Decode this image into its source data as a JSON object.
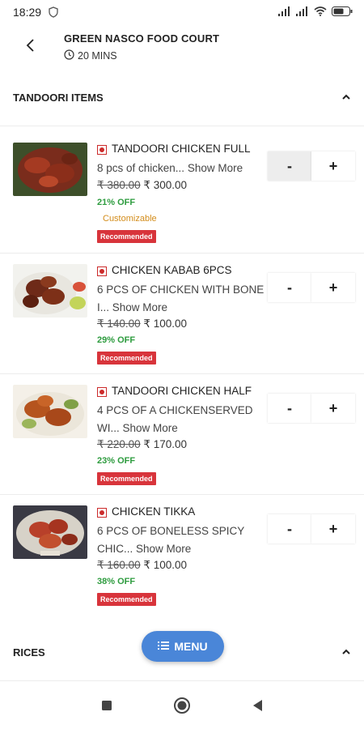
{
  "status": {
    "time": "18:29"
  },
  "header": {
    "title": "GREEN NASCO FOOD COURT",
    "eta": "20 MINS"
  },
  "sections": [
    {
      "title": "TANDOORI ITEMS"
    },
    {
      "title": "RICES"
    }
  ],
  "items": [
    {
      "name": "TANDOORI CHICKEN FULL",
      "desc": "8 pcs of chicken...",
      "more": "Show More",
      "old_price": "₹ 380.00",
      "price": "₹ 300.00",
      "off": "21% OFF",
      "custom": "Customizable",
      "badge": "Recommended"
    },
    {
      "name": "CHICKEN KABAB 6PCS",
      "desc": "6 PCS OF CHICKEN WITH BONE I...",
      "more": "Show More",
      "old_price": "₹ 140.00",
      "price": "₹ 100.00",
      "off": "29% OFF",
      "badge": "Recommended"
    },
    {
      "name": "TANDOORI CHICKEN HALF",
      "desc": "4 PCS OF A CHICKENSERVED WI...",
      "more": "Show More",
      "old_price": "₹ 220.00",
      "price": "₹ 170.00",
      "off": "23% OFF",
      "badge": "Recommended"
    },
    {
      "name": "CHICKEN TIKKA",
      "desc": "6 PCS OF BONELESS SPICY CHIC...",
      "more": "Show More",
      "old_price": "₹ 160.00",
      "price": "₹ 100.00",
      "off": "38% OFF",
      "badge": "Recommended"
    }
  ],
  "stepper": {
    "minus": "-",
    "plus": "+"
  },
  "fab": {
    "label": "MENU"
  },
  "colors": {
    "accent": "#4a86d8",
    "discount": "#2e9c3f",
    "badge": "#d8343b",
    "custom": "#d38c1a"
  }
}
